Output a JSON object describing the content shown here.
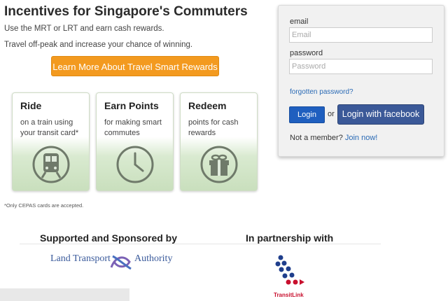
{
  "hero": {
    "title": "Incentives for Singapore's Commuters",
    "line1": "Use the MRT or LRT and earn cash rewards.",
    "line2": "Travel off-peak and increase your chance of winning.",
    "cta_label": "Learn More About Travel Smart Rewards"
  },
  "cards": [
    {
      "title": "Ride",
      "desc": "on a train using your transit card*",
      "icon": "train-icon"
    },
    {
      "title": "Earn Points",
      "desc": "for making smart commutes",
      "icon": "clock-icon"
    },
    {
      "title": "Redeem",
      "desc": "points for cash rewards",
      "icon": "gift-icon"
    }
  ],
  "note": "*Only CEPAS cards are accepted.",
  "sponsors": {
    "supported_title": "Supported and Sponsored by",
    "partner_title": "In partnership with",
    "lta_logo_text_1": "Land Transport",
    "lta_logo_text_2": "Authority",
    "transitlink_logo_text": "TransitLink"
  },
  "login": {
    "email_label": "email",
    "email_placeholder": "Email",
    "password_label": "password",
    "password_placeholder": "Password",
    "forgot_label": "forgotten password?",
    "login_label": "Login",
    "or_label": "or",
    "facebook_label": "Login with facebook",
    "member_text": "Not a member?",
    "join_label": "Join now!"
  },
  "colors": {
    "cta": "#f39a1f",
    "login_button": "#1f5fbf",
    "facebook_button": "#3b5998",
    "link": "#2a6ab5",
    "card_green": "#c9dfbd"
  }
}
